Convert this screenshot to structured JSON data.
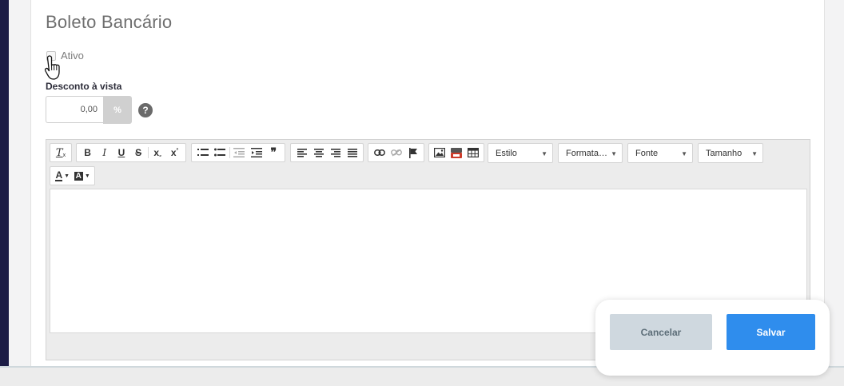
{
  "section": {
    "title": "Boleto Bancário"
  },
  "ativo": {
    "label": "Ativo",
    "checked": false
  },
  "desconto": {
    "label": "Desconto à vista",
    "value": "0,00",
    "unit": "%",
    "help": "?"
  },
  "editor": {
    "toolbar": {
      "format_combos": [
        {
          "label": "Estilo"
        },
        {
          "label": "Formata…"
        },
        {
          "label": "Fonte"
        },
        {
          "label": "Tamanho"
        }
      ],
      "icons": [
        "remove-format-icon",
        "bold-icon",
        "italic-icon",
        "underline-icon",
        "strikethrough-icon",
        "subscript-icon",
        "superscript-icon",
        "numbered-list-icon",
        "bulleted-list-icon",
        "decrease-indent-icon",
        "increase-indent-icon",
        "blockquote-icon",
        "align-left-icon",
        "align-center-icon",
        "align-right-icon",
        "justify-icon",
        "link-icon",
        "unlink-icon",
        "anchor-flag-icon",
        "image-icon",
        "youtube-icon",
        "table-icon",
        "text-color-icon",
        "background-color-icon"
      ]
    },
    "content": ""
  },
  "actions": {
    "cancel_label": "Cancelar",
    "save_label": "Salvar"
  },
  "colors": {
    "sidebar": "#1c1c45",
    "primary": "#2f8ded",
    "cancel_bg": "#cfd8df"
  }
}
